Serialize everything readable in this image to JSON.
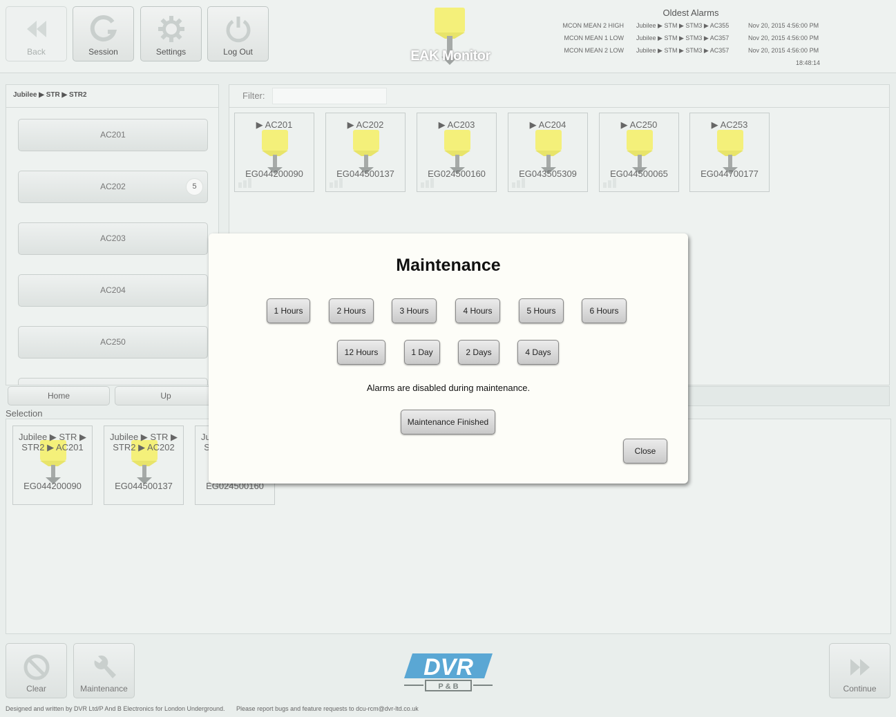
{
  "toolbar": {
    "back_label": "Back",
    "session_label": "Session",
    "settings_label": "Settings",
    "logout_label": "Log Out"
  },
  "app": {
    "title": "EAK Monitor"
  },
  "alarms": {
    "title": "Oldest Alarms",
    "rows": [
      {
        "type": "MCON MEAN 2 HIGH",
        "path": "Jubilee ▶ STM ▶ STM3 ▶ AC355",
        "time": "Nov 20, 2015 4:56:00 PM"
      },
      {
        "type": "MCON MEAN 1 LOW",
        "path": "Jubilee ▶ STM ▶ STM3 ▶ AC357",
        "time": "Nov 20, 2015 4:56:00 PM"
      },
      {
        "type": "MCON MEAN 2 LOW",
        "path": "Jubilee ▶ STM ▶ STM3 ▶ AC357",
        "time": "Nov 20, 2015 4:56:00 PM"
      }
    ],
    "clock": "18:48:14"
  },
  "nav": {
    "breadcrumb": "Jubilee ▶ STR ▶ STR2",
    "items": [
      {
        "label": "AC201",
        "badge": ""
      },
      {
        "label": "AC202",
        "badge": "5"
      },
      {
        "label": "AC203",
        "badge": ""
      },
      {
        "label": "AC204",
        "badge": ""
      },
      {
        "label": "AC250",
        "badge": ""
      }
    ],
    "home_label": "Home",
    "up_label": "Up"
  },
  "filter": {
    "label": "Filter:",
    "value": ""
  },
  "cards": [
    {
      "name": "▶ AC201",
      "serial": "EG044200090"
    },
    {
      "name": "▶ AC202",
      "serial": "EG044500137"
    },
    {
      "name": "▶ AC203",
      "serial": "EG024500160"
    },
    {
      "name": "▶ AC204",
      "serial": "EG043505309"
    },
    {
      "name": "▶ AC250",
      "serial": "EG044500065"
    },
    {
      "name": "▶ AC253",
      "serial": "EG044700177"
    }
  ],
  "selection": {
    "label": "Selection",
    "items": [
      {
        "path": "Jubilee ▶ STR ▶ STR2 ▶ AC201",
        "serial": "EG044200090"
      },
      {
        "path": "Jubilee ▶ STR ▶ STR2 ▶ AC202",
        "serial": "EG044500137"
      },
      {
        "path": "Jubilee ▶ STR ▶ STR2 ▶ AC203",
        "serial": "EG024500160"
      }
    ]
  },
  "bottom": {
    "clear_label": "Clear",
    "maintenance_label": "Maintenance",
    "continue_label": "Continue",
    "logo_text": "DVR",
    "logo_sub": "P & B"
  },
  "footer": {
    "credit": "Designed and written by DVR Ltd/P And B Electronics for London Underground.",
    "report": "Please report bugs and feature requests to dcu-rcm@dvr-ltd.co.uk"
  },
  "modal": {
    "title": "Maintenance",
    "row1": [
      "1 Hours",
      "2 Hours",
      "3 Hours",
      "4 Hours",
      "5 Hours",
      "6 Hours"
    ],
    "row2": [
      "12 Hours",
      "1 Day",
      "2 Days",
      "4 Days"
    ],
    "note": "Alarms are disabled during maintenance.",
    "finished_label": "Maintenance Finished",
    "close_label": "Close"
  },
  "colors": {
    "device_yellow": "#f4f07a",
    "device_grey": "#9ea3a1",
    "logo_blue": "#5aa7d4"
  }
}
